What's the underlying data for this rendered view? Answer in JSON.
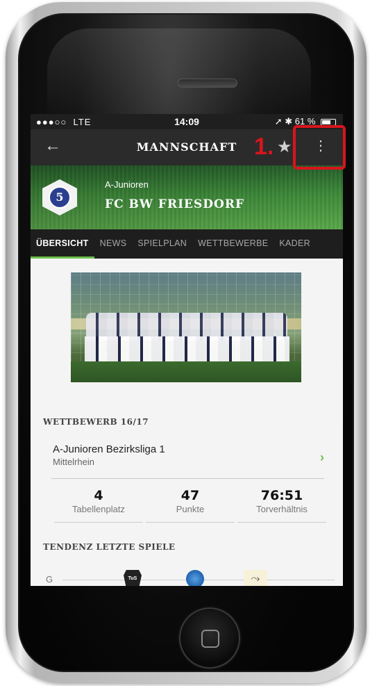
{
  "status_bar": {
    "signal": "●●●○○",
    "carrier": "LTE",
    "time": "14:09",
    "right": "➚ ✱ 61 %",
    "battery_level": 0.61
  },
  "top_bar": {
    "title": "MANNSCHAFT",
    "back_icon": "arrow-left-icon",
    "favorite_icon": "star-icon",
    "more_icon": "more-vertical-icon"
  },
  "hero": {
    "subtitle": "A-Junioren",
    "team": "FC BW FRIESDORF",
    "logo_letter": "5"
  },
  "tabs": [
    {
      "label": "ÜBERSICHT",
      "active": true
    },
    {
      "label": "NEWS",
      "active": false
    },
    {
      "label": "SPIELPLAN",
      "active": false
    },
    {
      "label": "WETTBEWERBE",
      "active": false
    },
    {
      "label": "KADER",
      "active": false
    }
  ],
  "competition": {
    "section_title": "WETTBEWERB 16/17",
    "name": "A-Junioren Bezirksliga 1",
    "region": "Mittelrhein",
    "chevron": "›"
  },
  "stats": [
    {
      "value": "4",
      "label": "Tabellenplatz"
    },
    {
      "value": "47",
      "label": "Punkte"
    },
    {
      "value": "76:51",
      "label": "Torverhältnis"
    }
  ],
  "trend": {
    "section_title": "TENDENZ LETZTE SPIELE",
    "result_letter": "G",
    "club1_text": "TuS"
  },
  "annotation": {
    "step": "1.",
    "color": "#d9141c"
  },
  "colors": {
    "accent": "#6cc04a",
    "topbar": "#2b2b2b",
    "tabbar": "#1e1e1e"
  }
}
